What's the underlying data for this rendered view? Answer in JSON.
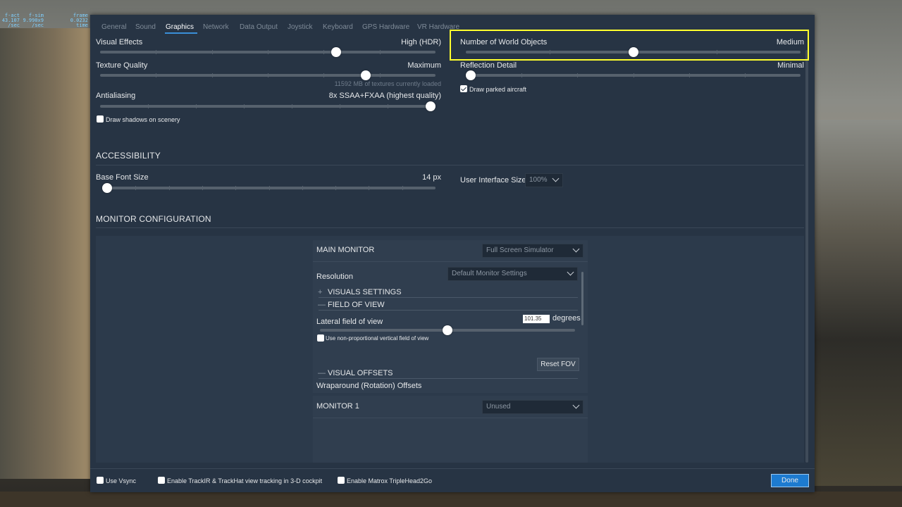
{
  "hud": {
    "col1": [
      "f-act",
      "43.107",
      "/sec"
    ],
    "col2": [
      "f-sim",
      "9.990x9",
      "/sec"
    ],
    "col3": [
      "frame",
      "0.0232",
      "time"
    ]
  },
  "tabs": [
    "General",
    "Sound",
    "Graphics",
    "Network",
    "Data Output",
    "Joystick",
    "Keyboard",
    "GPS Hardware",
    "VR Hardware"
  ],
  "graphics": {
    "visual_effects": {
      "label": "Visual Effects",
      "value": "High (HDR)",
      "level": 0.71
    },
    "texture_quality": {
      "label": "Texture Quality",
      "value": "Maximum",
      "level": 0.8,
      "note": "11592 MB of textures currently loaded"
    },
    "antialiasing": {
      "label": "Antialiasing",
      "value": "8x SSAA+FXAA (highest quality)",
      "level": 1.0
    },
    "draw_shadows": {
      "label": "Draw shadows on scenery",
      "checked": false
    },
    "world_objects": {
      "label": "Number of World Objects",
      "value": "Medium",
      "level": 0.5
    },
    "reflection_detail": {
      "label": "Reflection Detail",
      "value": "Minimal",
      "level": 0.0
    },
    "draw_parked": {
      "label": "Draw parked aircraft",
      "checked": true
    }
  },
  "accessibility": {
    "heading": "ACCESSIBILITY",
    "base_font": {
      "label": "Base Font Size",
      "value": "14 px",
      "level": 0.0
    },
    "ui_size": {
      "label": "User Interface Size",
      "value": "100%"
    }
  },
  "monitor_config": {
    "heading": "MONITOR CONFIGURATION",
    "main": {
      "title": "MAIN MONITOR",
      "mode": "Full Screen Simulator",
      "resolution_label": "Resolution",
      "resolution_value": "Default Monitor Settings",
      "visuals_settings": "VISUALS SETTINGS",
      "field_of_view": "FIELD OF VIEW",
      "lateral_fov_label": "Lateral field of view",
      "lateral_fov_value": "101.35",
      "lateral_fov_unit": "degrees",
      "lateral_fov_level": 0.5,
      "non_proportional": "Use non-proportional vertical field of view",
      "reset_fov": "Reset FOV",
      "visual_offsets": "VISUAL OFFSETS",
      "wraparound": "Wraparound (Rotation) Offsets"
    },
    "monitor1": {
      "title": "MONITOR 1",
      "mode": "Unused"
    }
  },
  "footer": {
    "use_vsync": "Use Vsync",
    "trackir": "Enable TrackIR & TrackHat view tracking in 3-D cockpit",
    "matrox": "Enable Matrox TripleHead2Go",
    "done": "Done"
  },
  "colors": {
    "accent": "#1d7bd0",
    "highlight": "#ffff2e",
    "panel": "#273444"
  }
}
